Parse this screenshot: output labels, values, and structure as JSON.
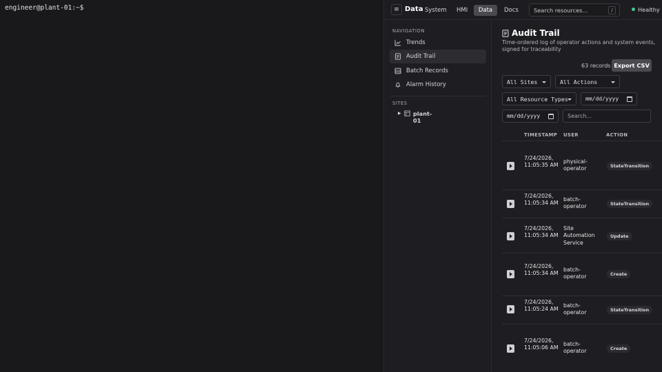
{
  "terminal": {
    "prompt": "engineer@plant-01:~$"
  },
  "topbar": {
    "menu_icon": "hamburger-icon",
    "brand": "Data",
    "tabs": [
      {
        "label": "System",
        "active": false
      },
      {
        "label": "HMI",
        "active": false
      },
      {
        "label": "Data",
        "active": true
      },
      {
        "label": "Docs",
        "active": false
      }
    ],
    "search_placeholder": "Search resources...",
    "search_shortcut": "/",
    "status": "Healthy",
    "status_color": "#3ecf8e"
  },
  "sidebar": {
    "nav_label": "NAVIGATION",
    "items": [
      {
        "label": "Trends",
        "icon": "chart-line-icon",
        "active": false
      },
      {
        "label": "Audit Trail",
        "icon": "document-icon",
        "active": true
      },
      {
        "label": "Batch Records",
        "icon": "table-icon",
        "active": false
      },
      {
        "label": "Alarm History",
        "icon": "bell-icon",
        "active": false
      }
    ],
    "sites_label": "SITES",
    "sites": [
      {
        "label": "plant-01",
        "icon": "building-icon"
      }
    ]
  },
  "main": {
    "title": "Audit Trail",
    "description": "Time-ordered log of operator actions and system events, signed for traceability",
    "record_count": "63 records",
    "export_label": "Export CSV",
    "filters": {
      "sites": "All Sites",
      "actions": "All Actions",
      "resource_types": "All Resource Types",
      "date_from": "mm/dd/yyyy",
      "date_to": "mm/dd/yyyy",
      "search_placeholder": "Search..."
    },
    "table": {
      "headers": [
        "TIMESTAMP",
        "USER",
        "ACTION"
      ],
      "rows": [
        {
          "timestamp": "7/24/2026, 11:05:35 AM",
          "user": "physical-operator",
          "action": "StateTransition"
        },
        {
          "timestamp": "7/24/2026, 11:05:34 AM",
          "user": "batch-operator",
          "action": "StateTransition"
        },
        {
          "timestamp": "7/24/2026, 11:05:34 AM",
          "user": "Site Automation Service",
          "action": "Update"
        },
        {
          "timestamp": "7/24/2026, 11:05:34 AM",
          "user": "batch-operator",
          "action": "Create"
        },
        {
          "timestamp": "7/24/2026, 11:05:24 AM",
          "user": "batch-operator",
          "action": "StateTransition"
        },
        {
          "timestamp": "7/24/2026, 11:05:06 AM",
          "user": "batch-operator",
          "action": "Create"
        }
      ]
    }
  }
}
